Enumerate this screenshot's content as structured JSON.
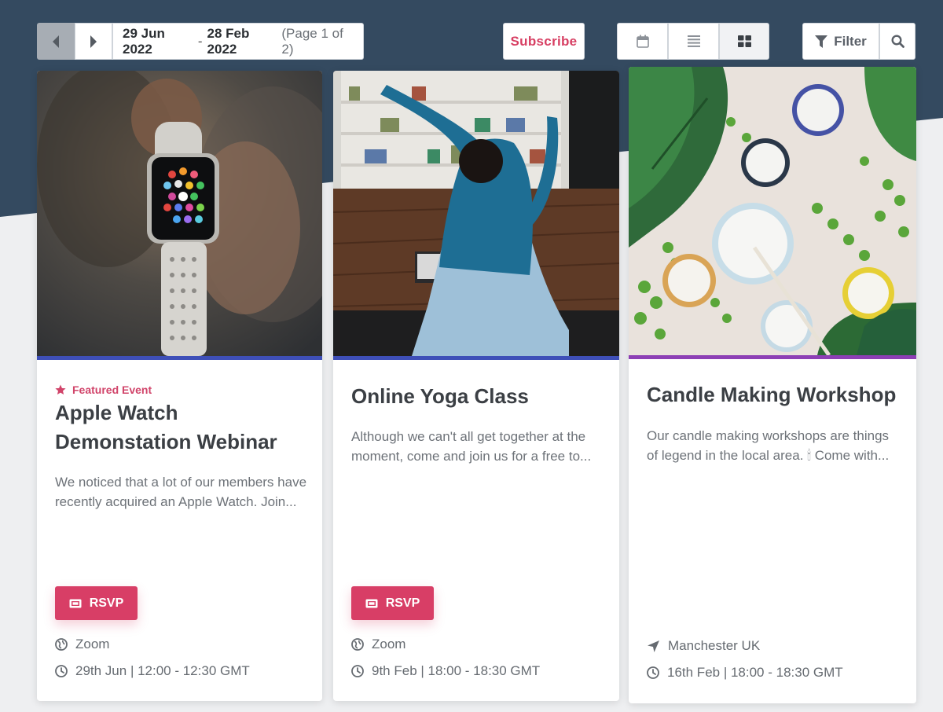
{
  "toolbar": {
    "date_start": "29 Jun 2022",
    "date_sep": "-",
    "date_end": "28 Feb 2022",
    "page_info": "(Page 1 of 2)",
    "subscribe_label": "Subscribe",
    "filter_label": "Filter"
  },
  "events": [
    {
      "featured_label": "Featured Event",
      "title": "Apple Watch Demonstation Webinar",
      "description": "We noticed that a lot of our members have recently acquired an Apple Watch. Join...",
      "rsvp_label": "RSVP",
      "location": "Zoom",
      "time": "29th Jun | 12:00 - 12:30 GMT",
      "accent_color": "#3e4fb8"
    },
    {
      "title": "Online Yoga Class",
      "description": "Although we can't all get together at the moment, come and join us for a free to...",
      "rsvp_label": "RSVP",
      "location": "Zoom",
      "time": "9th Feb | 18:00 - 18:30 GMT",
      "accent_color": "#3e4fb8"
    },
    {
      "title": "Candle Making Workshop",
      "description": "Our candle making workshops are things of legend in the local area. 🕯 Come with...",
      "location": "Manchester UK",
      "time": "16th Feb | 18:00 - 18:30 GMT",
      "accent_color": "#8d3fb5"
    }
  ],
  "colors": {
    "header_bg": "#344a60",
    "brand_pink": "#d83e66"
  }
}
